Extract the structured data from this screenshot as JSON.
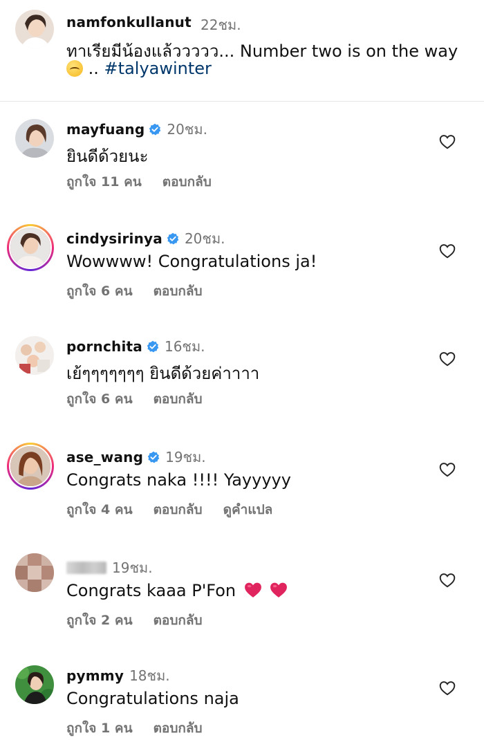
{
  "caption": {
    "username": "namfonkullanut",
    "time": "22ชม.",
    "text_line1": "ทาเรียมีน้องแล้ววววว... Number two is on the way",
    "text_line2_suffix": "..",
    "hashtag": "#talyawinter",
    "emoji": "upside-down-face"
  },
  "comments": [
    {
      "username": "mayfuang",
      "verified": true,
      "time": "20ชม.",
      "text": "ยินดีด้วยนะ",
      "likes": "ถูกใจ 11 คน",
      "reply": "ตอบกลับ",
      "translate": ""
    },
    {
      "username": "cindysirinya",
      "verified": true,
      "time": "20ชม.",
      "text": "Wowwww! Congratulations ja!",
      "likes": "ถูกใจ 6 คน",
      "reply": "ตอบกลับ",
      "translate": ""
    },
    {
      "username": "pornchita",
      "verified": true,
      "time": "16ชม.",
      "text": "เย้ๆๆๆๆๆๆๆ ยินดีด้วยค่าาาา",
      "likes": "ถูกใจ 6 คน",
      "reply": "ตอบกลับ",
      "translate": ""
    },
    {
      "username": "ase_wang",
      "verified": true,
      "time": "19ชม.",
      "text": "Congrats naka !!!! Yayyyyy",
      "likes": "ถูกใจ 4 คน",
      "reply": "ตอบกลับ",
      "translate": "ดูคำแปล"
    },
    {
      "username": "",
      "verified": false,
      "time": "19ชม.",
      "text": "Congrats kaaa P'Fon",
      "likes": "ถูกใจ 2 คน",
      "reply": "ตอบกลับ",
      "translate": ""
    },
    {
      "username": "pymmy",
      "verified": false,
      "time": "18ชม.",
      "text": "Congratulations naja",
      "likes": "ถูกใจ 1 คน",
      "reply": "ตอบกลับ",
      "translate": ""
    }
  ],
  "colors": {
    "text": "#111111",
    "secondary": "#737373",
    "verified": "#3897f0",
    "hashtag": "#00376b",
    "heart_emoji": "#e0245e"
  }
}
